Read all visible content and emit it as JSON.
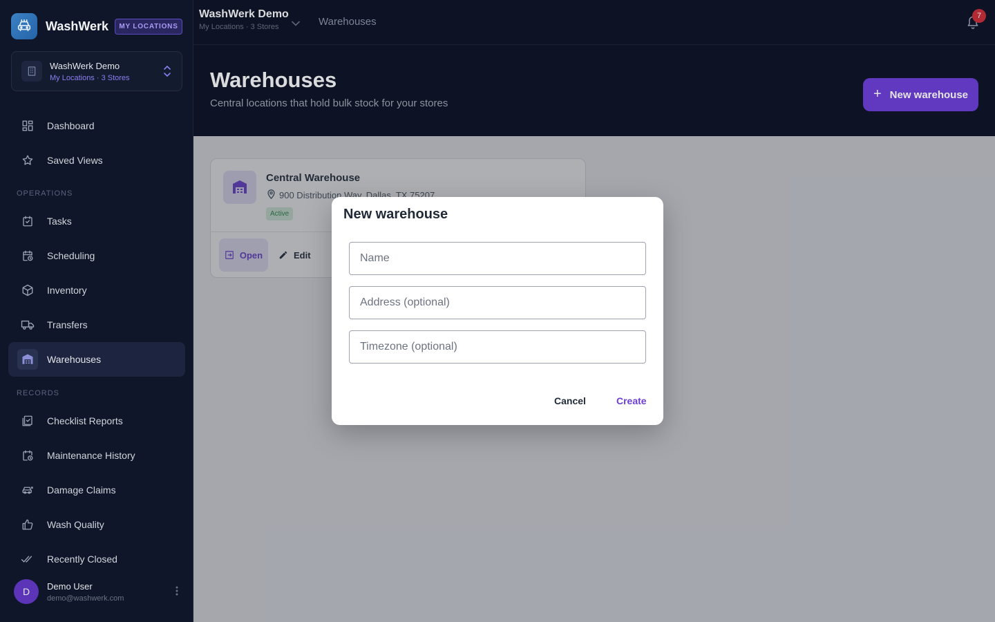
{
  "brand": {
    "name": "WashWerk",
    "badge": "MY LOCATIONS",
    "accent": "#6d3fd6"
  },
  "org_switcher": {
    "name": "WashWerk Demo",
    "subtitle": "My Locations · 3 Stores"
  },
  "sidebar": {
    "items": [
      {
        "label": "Dashboard",
        "icon": "dashboard-icon"
      },
      {
        "label": "Saved Views",
        "icon": "star-icon"
      },
      {
        "label": "Tasks",
        "icon": "task-check-icon"
      },
      {
        "label": "Scheduling",
        "icon": "calendar-clock-icon"
      },
      {
        "label": "Inventory",
        "icon": "box-icon"
      },
      {
        "label": "Transfers",
        "icon": "truck-icon"
      },
      {
        "label": "Warehouses",
        "icon": "warehouse-icon",
        "active": true
      },
      {
        "label": "Checklist Reports",
        "icon": "clipboard-check-icon"
      },
      {
        "label": "Maintenance History",
        "icon": "calendar-history-icon"
      },
      {
        "label": "Damage Claims",
        "icon": "car-damage-icon"
      },
      {
        "label": "Wash Quality",
        "icon": "thumbs-up-icon"
      },
      {
        "label": "Recently Closed",
        "icon": "double-check-icon"
      }
    ],
    "sections": {
      "operations": "OPERATIONS",
      "records": "RECORDS"
    }
  },
  "user": {
    "initial": "D",
    "name": "Demo User",
    "email": "demo@washwerk.com"
  },
  "topbar": {
    "org_name": "WashWerk Demo",
    "org_subtitle": "My Locations · 3 Stores",
    "page": "Warehouses",
    "notification_count": "7"
  },
  "header": {
    "title": "Warehouses",
    "subtitle": "Central locations that hold bulk stock for your stores",
    "new_button": "New warehouse"
  },
  "warehouse_card": {
    "name": "Central Warehouse",
    "address": "900 Distribution Way, Dallas, TX 75207",
    "status": "Active",
    "open_label": "Open",
    "edit_label": "Edit"
  },
  "dialog": {
    "title": "New warehouse",
    "name_placeholder": "Name",
    "address_placeholder": "Address (optional)",
    "timezone_placeholder": "Timezone (optional)",
    "name_value": "",
    "address_value": "",
    "timezone_value": "",
    "cancel_label": "Cancel",
    "create_label": "Create"
  }
}
